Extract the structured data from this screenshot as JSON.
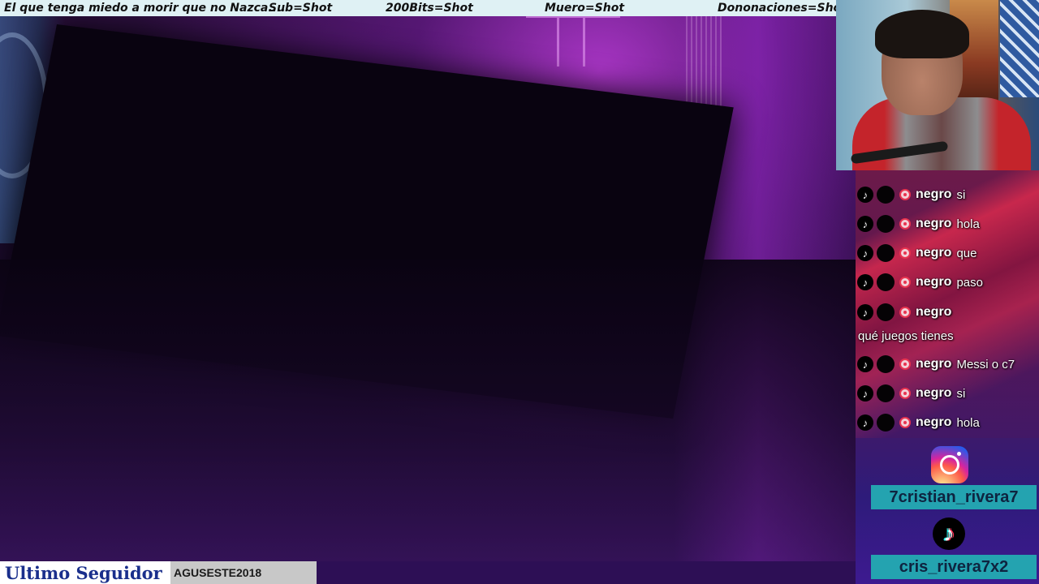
{
  "ticker": {
    "items": [
      "El que tenga miedo a morir que no Nazca....",
      "Sub=Shot",
      "200Bits=Shot",
      "Muero=Shot",
      "Dononaciones=Shot"
    ]
  },
  "chat": {
    "messages": [
      {
        "user": "negro",
        "text": "si"
      },
      {
        "user": "negro",
        "text": "hola"
      },
      {
        "user": "negro",
        "text": "que"
      },
      {
        "user": "negro",
        "text": "paso"
      },
      {
        "user": "negro",
        "text": "qué juegos tienes"
      },
      {
        "user": "negro",
        "text": "Messi o c7"
      },
      {
        "user": "negro",
        "text": "si"
      },
      {
        "user": "negro",
        "text": "hola"
      }
    ]
  },
  "socials": {
    "instagram_handle": "7cristian_rivera7",
    "tiktok_handle": "cris_rivera7x2"
  },
  "bottom": {
    "last_follower_label": "Ultimo Seguidor",
    "last_follower_name": "AGUSESTE2018"
  },
  "colors": {
    "ticker_bg": "#dff1f4",
    "handle_bg": "#24a3b0",
    "bottom_label_text": "#1a2f8c",
    "chat_accent": "#e8334f"
  },
  "icons": {
    "chat_platform": "tiktok-icon",
    "chat_badge": "gift-badge-icon",
    "social_1": "instagram-icon",
    "social_2": "tiktok-icon"
  }
}
